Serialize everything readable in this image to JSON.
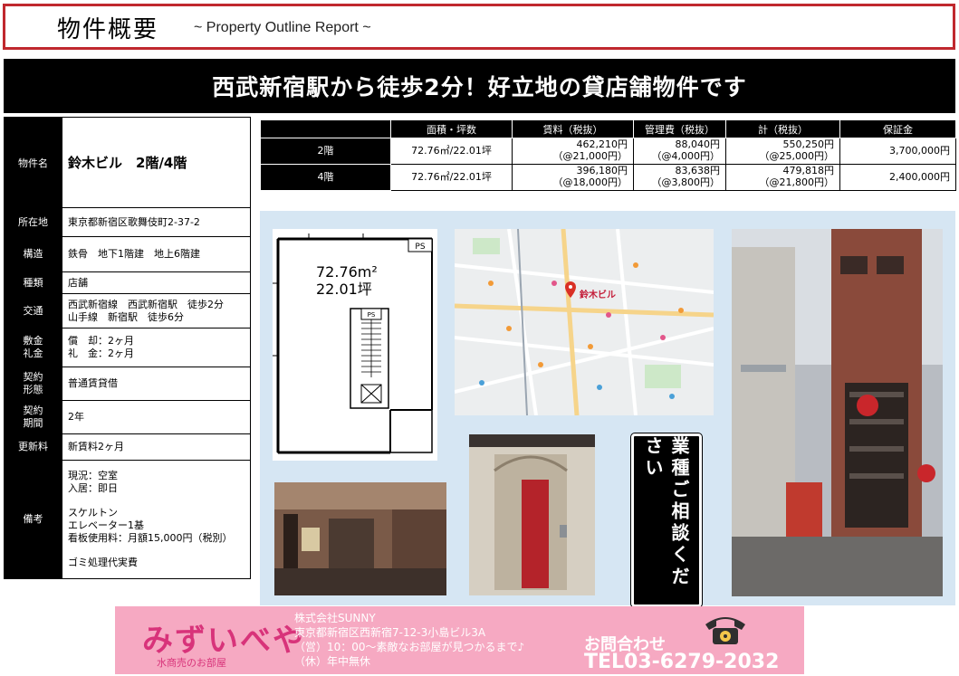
{
  "header": {
    "title_jp": "物件概要",
    "title_en": "~ Property Outline Report ~"
  },
  "banner": {
    "headline": "西武新宿駅から徒歩2分！好立地の貸店舗物件です"
  },
  "info": {
    "name_label": "物件名",
    "name_value": "鈴木ビル　2階/4階",
    "rows": [
      {
        "label": "所在地",
        "value": "東京都新宿区歌舞伎町2-37-2"
      },
      {
        "label": "構造",
        "value": "鉄骨　地下1階建　地上6階建"
      },
      {
        "label": "種類",
        "value": "店舗"
      },
      {
        "label": "交通",
        "value": "西武新宿線　西武新宿駅　徒歩2分\n山手線　新宿駅　徒歩6分"
      },
      {
        "label": "敷金\n礼金",
        "value": "償　却：2ヶ月\n礼　金：2ヶ月"
      },
      {
        "label": "契約\n形態",
        "value": "普通賃貸借"
      },
      {
        "label": "契約\n期間",
        "value": "2年"
      },
      {
        "label": "更新料",
        "value": "新賃料2ヶ月"
      },
      {
        "label": "備考",
        "value": "現況：空室\n入居：即日\n\nスケルトン\nエレベーター1基\n看板使用料：月額15,000円（税別）\n\nゴミ処理代実費"
      }
    ]
  },
  "rent_table": {
    "headers": [
      "",
      "面積・坪数",
      "賃料（税抜）",
      "管理費（税抜）",
      "計（税抜）",
      "保証金"
    ],
    "rows": [
      {
        "floor": "2階",
        "area": "72.76㎡/22.01坪",
        "rent": "462,210円\n（@21,000円）",
        "mgmt": "88,040円\n（@4,000円）",
        "total": "550,250円\n（@25,000円）",
        "deposit": "3,700,000円"
      },
      {
        "floor": "4階",
        "area": "72.76㎡/22.01坪",
        "rent": "396,180円\n（@18,000円）",
        "mgmt": "83,638円\n（@3,800円）",
        "total": "479,818円\n（@21,800円）",
        "deposit": "2,400,000円"
      }
    ]
  },
  "floorplan": {
    "area_m2": "72.76m²",
    "area_tsubo": "22.01坪",
    "ps_label": "PS"
  },
  "map": {
    "marker_label": "鈴木ビル"
  },
  "badge": {
    "text": "業種ご相談ください"
  },
  "footer": {
    "logo_text": "みずいべや",
    "logo_sub": "水商売のお部屋",
    "company_lines": "株式会社SUNNY\n東京都新宿区西新宿7-12-3小島ビル3A\n（営）10：00～素敵なお部屋が見つかるまで♪\n（休）年中無休",
    "contact_label": "お問合わせ",
    "tel": "TEL03-6279-2032"
  },
  "colors": {
    "header_border": "#c0282e",
    "photo_bg": "#d6e6f3",
    "footer_bg": "#f6a9c2",
    "logo_pink": "#d8337a"
  }
}
